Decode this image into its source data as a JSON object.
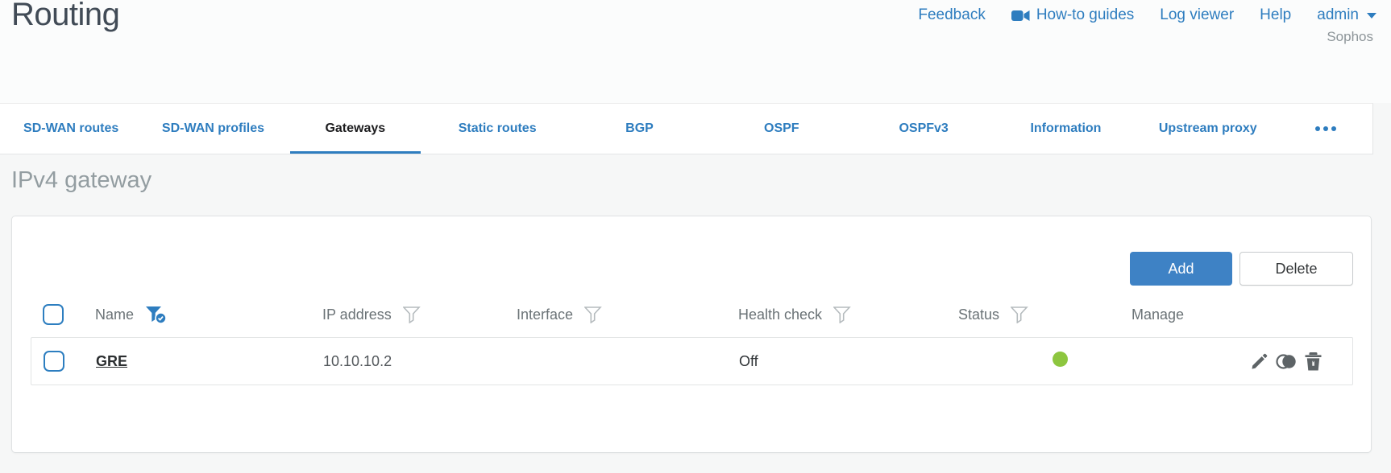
{
  "window": {
    "title": "Routing",
    "brand": "Sophos"
  },
  "top_nav": {
    "items": [
      {
        "label": "Feedback"
      },
      {
        "label": "How-to guides",
        "icon": "video-camera-icon"
      },
      {
        "label": "Log viewer"
      },
      {
        "label": "Help"
      },
      {
        "label": "admin",
        "icon": "caret-down-icon"
      }
    ]
  },
  "tabs": {
    "items": [
      {
        "label": "SD-WAN routes",
        "active": false
      },
      {
        "label": "SD-WAN profiles",
        "active": false
      },
      {
        "label": "Gateways",
        "active": true
      },
      {
        "label": "Static routes",
        "active": false
      },
      {
        "label": "BGP",
        "active": false
      },
      {
        "label": "OSPF",
        "active": false
      },
      {
        "label": "OSPFv3",
        "active": false
      },
      {
        "label": "Information",
        "active": false
      },
      {
        "label": "Upstream proxy",
        "active": false
      }
    ],
    "more_icon": "ellipsis-icon"
  },
  "content": {
    "section_heading": "IPv4 gateway",
    "toolbar": {
      "add_label": "Add",
      "delete_label": "Delete"
    },
    "table": {
      "columns": [
        {
          "label": "Name",
          "filter": "active"
        },
        {
          "label": "IP address",
          "filter": "default"
        },
        {
          "label": "Interface",
          "filter": "default"
        },
        {
          "label": "Health check",
          "filter": "default"
        },
        {
          "label": "Status",
          "filter": "default"
        },
        {
          "label": "Manage",
          "filter": "none"
        }
      ],
      "rows": [
        {
          "name": "GRE",
          "ip_address": "10.10.10.2",
          "interface": "",
          "health_check": "Off",
          "status": "up",
          "manage_icons": [
            "edit-pencil-icon",
            "clone-icon",
            "delete-trash-icon"
          ]
        }
      ]
    }
  },
  "colors": {
    "accent_blue": "#2e7dbf",
    "button_blue": "#3e82c5",
    "status_green": "#8dc63f",
    "active_tab_text": "#1d1d1f"
  }
}
